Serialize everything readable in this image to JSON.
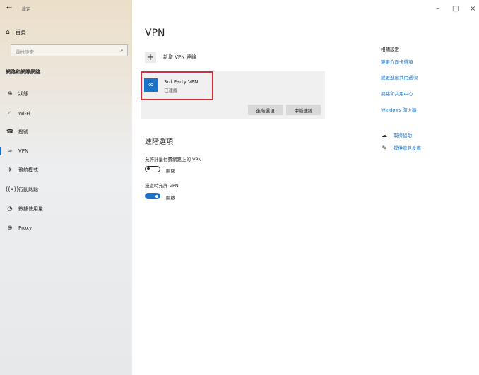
{
  "window": {
    "title": "設定",
    "controls": {
      "minimize": "–",
      "maximize": "□",
      "close": "×"
    }
  },
  "sidebar": {
    "home_label": "首頁",
    "search_placeholder": "尋找設定",
    "section_title": "網路和網際網路",
    "items": [
      {
        "label": "狀態",
        "icon": "globe-status-icon"
      },
      {
        "label": "Wi-Fi",
        "icon": "wifi-icon"
      },
      {
        "label": "撥號",
        "icon": "dialup-icon"
      },
      {
        "label": "VPN",
        "icon": "vpn-icon",
        "active": true
      },
      {
        "label": "飛航模式",
        "icon": "airplane-icon"
      },
      {
        "label": "行動熱點",
        "icon": "hotspot-icon"
      },
      {
        "label": "數據使用量",
        "icon": "data-usage-icon"
      },
      {
        "label": "Proxy",
        "icon": "proxy-globe-icon"
      }
    ]
  },
  "main": {
    "title": "VPN",
    "add_vpn_label": "新增 VPN 連線",
    "vpn_connection": {
      "name": "3rd Party VPN",
      "status": "已連線",
      "buttons": {
        "advanced": "進階選項",
        "disconnect": "中斷連線"
      }
    },
    "advanced_title": "進階選項",
    "metered": {
      "label": "允許計量付費網路上的 VPN",
      "state": "關閉",
      "on": false
    },
    "roaming": {
      "label": "漫遊時允許 VPN",
      "state": "開啟",
      "on": true
    }
  },
  "related": {
    "title": "相關設定",
    "links": [
      "變更介面卡選項",
      "變更進階共用選項",
      "網路和共用中心",
      "Windows 防火牆"
    ],
    "help": [
      {
        "label": "取得協助",
        "icon": "help-chat-icon"
      },
      {
        "label": "提供意見反應",
        "icon": "feedback-icon"
      }
    ]
  },
  "colors": {
    "accent": "#1a73c8",
    "highlight_border": "#d1303a"
  }
}
